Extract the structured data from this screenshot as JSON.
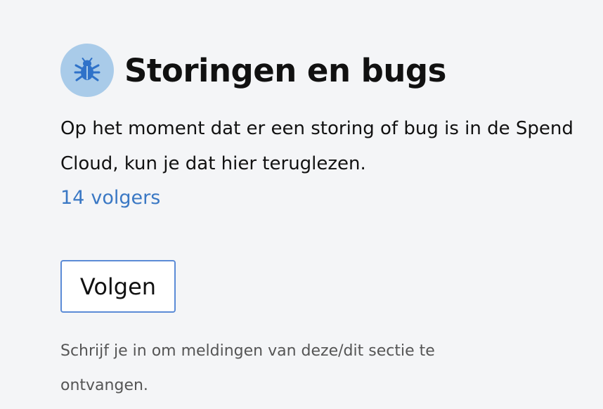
{
  "section": {
    "title": "Storingen en bugs",
    "icon": "bug-icon",
    "icon_bg_color": "#a9cbe9",
    "icon_color": "#2f72c9",
    "description": "Op het moment dat er een storing of bug is in de Spend Cloud, kun je dat hier teruglezen.",
    "followers_count": "14",
    "followers_label": "volgers",
    "follow_button_label": "Volgen",
    "subscribe_hint": "Schrijf je in om meldingen van deze/dit sectie te ontvangen.",
    "link_color": "#3a78c4",
    "button_border_color": "#5b8bd6"
  }
}
